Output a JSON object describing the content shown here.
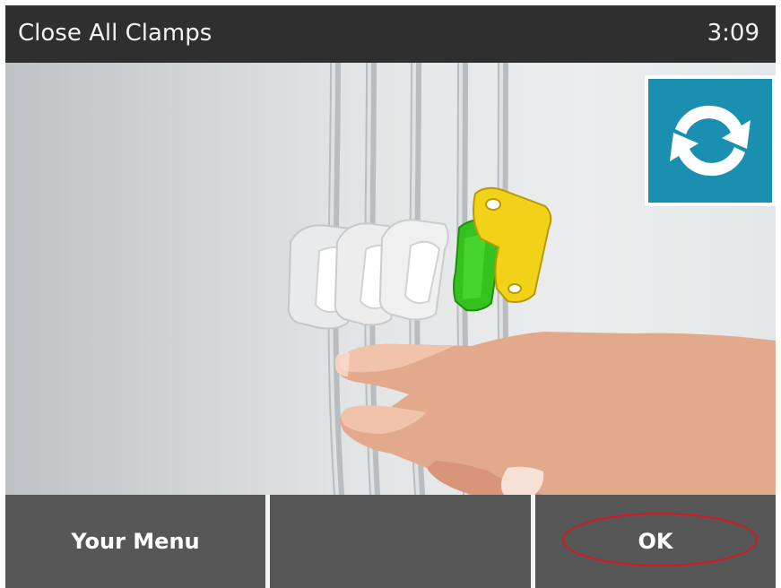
{
  "header": {
    "title": "Close All Clamps",
    "time": "3:09"
  },
  "illustration": {
    "description_icon": "clamps-illustration",
    "refresh_icon": "refresh-icon"
  },
  "footer": {
    "left_label": "Your Menu",
    "middle_label": "",
    "right_label": "OK"
  },
  "colors": {
    "titlebar": "#2f2f2f",
    "footer_button": "#575757",
    "refresh_button": "#1a8fb0",
    "clamp_white": "#f4f4f4",
    "clamp_green": "#32c020",
    "clamp_yellow": "#f2d21a",
    "highlight_ring": "#e0141b"
  }
}
